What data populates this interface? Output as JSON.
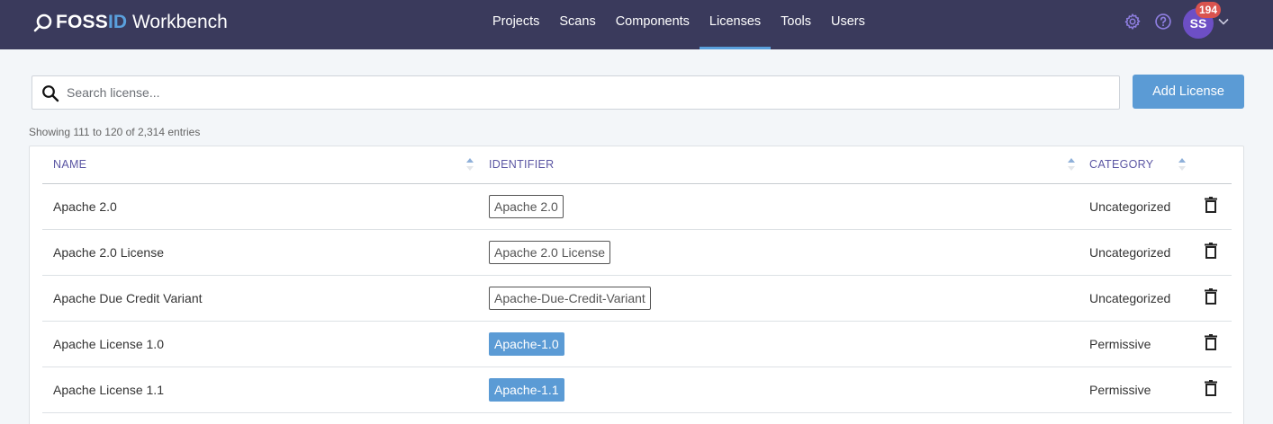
{
  "brand": {
    "part1": "FOSS",
    "part2": "ID",
    "part3": "Workbench",
    "accent_color": "#5aa0dd",
    "bar_color": "#3a3a5c"
  },
  "nav": {
    "items": [
      {
        "label": "Projects"
      },
      {
        "label": "Scans"
      },
      {
        "label": "Components"
      },
      {
        "label": "Licenses",
        "active": true
      },
      {
        "label": "Tools"
      },
      {
        "label": "Users"
      }
    ]
  },
  "user": {
    "initials": "SS",
    "notifications": "194",
    "avatar_color": "#6d4fc5"
  },
  "icons": {
    "settings": "gear-icon",
    "help": "help-icon",
    "menu": "chevron-down-icon",
    "search": "search-icon",
    "delete": "trash-icon",
    "sort": "sort-icon"
  },
  "search": {
    "placeholder": "Search license...",
    "value": ""
  },
  "add_button": {
    "label": "Add License"
  },
  "entries_info": "Showing 111 to 120 of 2,314 entries",
  "table": {
    "columns": {
      "name": "NAME",
      "identifier": "IDENTIFIER",
      "category": "CATEGORY"
    },
    "rows": [
      {
        "name": "Apache 2.0",
        "identifier": "Apache 2.0",
        "identifier_style": "outline",
        "category": "Uncategorized"
      },
      {
        "name": "Apache 2.0 License",
        "identifier": "Apache 2.0 License",
        "identifier_style": "outline",
        "category": "Uncategorized"
      },
      {
        "name": "Apache Due Credit Variant",
        "identifier": "Apache-Due-Credit-Variant",
        "identifier_style": "outline",
        "category": "Uncategorized"
      },
      {
        "name": "Apache License 1.0",
        "identifier": "Apache-1.0",
        "identifier_style": "filled",
        "category": "Permissive"
      },
      {
        "name": "Apache License 1.1",
        "identifier": "Apache-1.1",
        "identifier_style": "filled",
        "category": "Permissive"
      }
    ]
  }
}
